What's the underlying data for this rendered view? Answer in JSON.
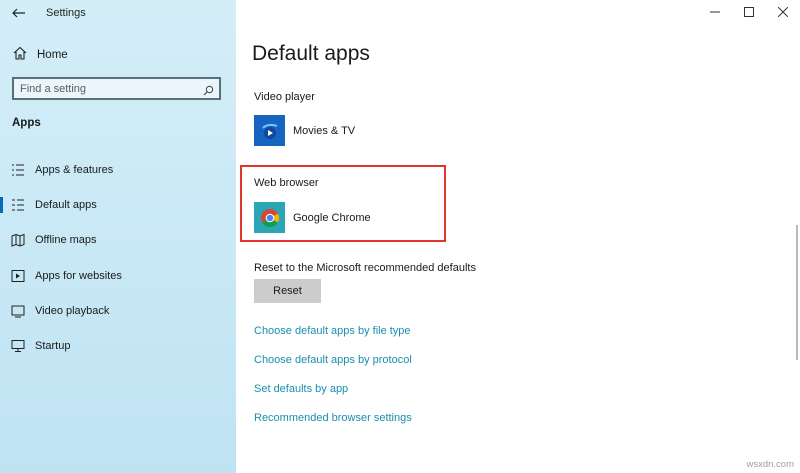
{
  "window": {
    "title": "Settings",
    "controls": [
      "minimize-icon",
      "maximize-icon",
      "close-icon"
    ]
  },
  "sidebar": {
    "home_label": "Home",
    "search_placeholder": "Find a setting",
    "section_title": "Apps",
    "items": [
      {
        "label": "Apps & features",
        "icon": "list-icon",
        "active": false
      },
      {
        "label": "Default apps",
        "icon": "default-apps-icon",
        "active": true
      },
      {
        "label": "Offline maps",
        "icon": "map-icon",
        "active": false
      },
      {
        "label": "Apps for websites",
        "icon": "link-icon",
        "active": false
      },
      {
        "label": "Video playback",
        "icon": "video-icon",
        "active": false
      },
      {
        "label": "Startup",
        "icon": "startup-icon",
        "active": false
      }
    ]
  },
  "main": {
    "title": "Default apps",
    "video_player": {
      "label": "Video player",
      "app": "Movies & TV",
      "icon": "movies-tv-icon"
    },
    "web_browser": {
      "label": "Web browser",
      "app": "Google Chrome",
      "icon": "chrome-icon"
    },
    "reset": {
      "label": "Reset to the Microsoft recommended defaults",
      "button": "Reset"
    },
    "links": [
      "Choose default apps by file type",
      "Choose default apps by protocol",
      "Set defaults by app",
      "Recommended browser settings"
    ]
  },
  "colors": {
    "sidebar_bg": "#c8e8f5",
    "accent": "#0a68b5",
    "link": "#1a8fae",
    "highlight": "#e0352b"
  },
  "watermark": "wsxdn.com"
}
